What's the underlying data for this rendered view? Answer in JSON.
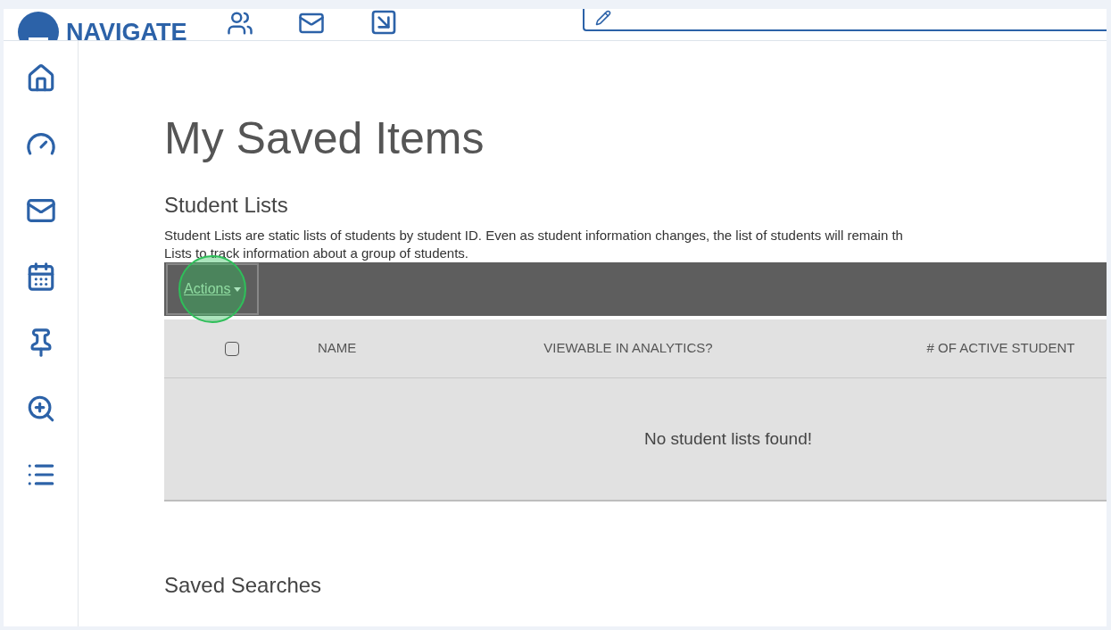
{
  "header": {
    "brand": "NAVIGATE"
  },
  "sidebar": {
    "items": [
      {
        "kind": "home"
      },
      {
        "kind": "dashboard"
      },
      {
        "kind": "mail"
      },
      {
        "kind": "calendar"
      },
      {
        "kind": "pin"
      },
      {
        "kind": "search"
      },
      {
        "kind": "list"
      }
    ]
  },
  "page": {
    "title": "My Saved Items"
  },
  "student_lists": {
    "heading": "Student Lists",
    "description_lines": [
      "Student Lists are static lists of students by student ID. Even as student information changes, the list of students will remain th",
      "Lists to track information about a group of students."
    ],
    "actions": {
      "label": "Actions",
      "highlighted": true
    },
    "table": {
      "select_all_checked": false,
      "columns": [
        "NAME",
        "VIEWABLE IN ANALYTICS?",
        "# OF ACTIVE STUDENT"
      ],
      "empty_message": "No student lists found!"
    }
  },
  "saved_searches": {
    "heading": "Saved Searches"
  }
}
